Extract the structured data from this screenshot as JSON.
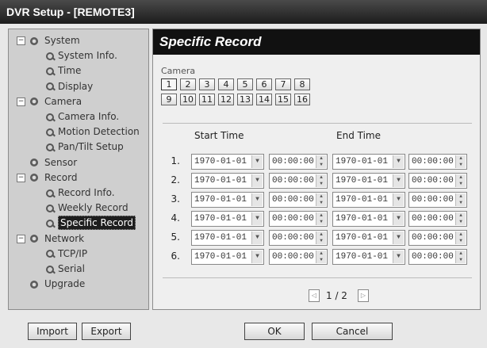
{
  "window": {
    "title": "DVR Setup - [REMOTE3]"
  },
  "sidebar": {
    "tree": [
      {
        "label": "System",
        "kind": "group",
        "expanded": true
      },
      {
        "label": "System Info.",
        "kind": "item"
      },
      {
        "label": "Time",
        "kind": "item"
      },
      {
        "label": "Display",
        "kind": "item"
      },
      {
        "label": "Camera",
        "kind": "group",
        "expanded": true
      },
      {
        "label": "Camera Info.",
        "kind": "item"
      },
      {
        "label": "Motion Detection",
        "kind": "item"
      },
      {
        "label": "Pan/Tilt Setup",
        "kind": "item"
      },
      {
        "label": "Sensor",
        "kind": "group",
        "expanded": false
      },
      {
        "label": "Record",
        "kind": "group",
        "expanded": true
      },
      {
        "label": "Record Info.",
        "kind": "item"
      },
      {
        "label": "Weekly Record",
        "kind": "item"
      },
      {
        "label": "Specific Record",
        "kind": "item",
        "selected": true
      },
      {
        "label": "Network",
        "kind": "group",
        "expanded": true
      },
      {
        "label": "TCP/IP",
        "kind": "item"
      },
      {
        "label": "Serial",
        "kind": "item"
      },
      {
        "label": "Upgrade",
        "kind": "group",
        "expanded": false
      }
    ],
    "expanded_symbol": "−"
  },
  "footer": {
    "import_label": "Import",
    "export_label": "Export",
    "ok_label": "OK",
    "cancel_label": "Cancel"
  },
  "main": {
    "title": "Specific Record",
    "camera_label": "Camera",
    "cameras": [
      "1",
      "2",
      "3",
      "4",
      "5",
      "6",
      "7",
      "8",
      "9",
      "10",
      "11",
      "12",
      "13",
      "14",
      "15",
      "16"
    ],
    "selected_camera": "1",
    "start_time_label": "Start Time",
    "end_time_label": "End Time",
    "rows": [
      {
        "num": "1.",
        "start_date": "1970-01-01",
        "start_time": "00:00:00",
        "end_date": "1970-01-01",
        "end_time": "00:00:00"
      },
      {
        "num": "2.",
        "start_date": "1970-01-01",
        "start_time": "00:00:00",
        "end_date": "1970-01-01",
        "end_time": "00:00:00"
      },
      {
        "num": "3.",
        "start_date": "1970-01-01",
        "start_time": "00:00:00",
        "end_date": "1970-01-01",
        "end_time": "00:00:00"
      },
      {
        "num": "4.",
        "start_date": "1970-01-01",
        "start_time": "00:00:00",
        "end_date": "1970-01-01",
        "end_time": "00:00:00"
      },
      {
        "num": "5.",
        "start_date": "1970-01-01",
        "start_time": "00:00:00",
        "end_date": "1970-01-01",
        "end_time": "00:00:00"
      },
      {
        "num": "6.",
        "start_date": "1970-01-01",
        "start_time": "00:00:00",
        "end_date": "1970-01-01",
        "end_time": "00:00:00"
      }
    ],
    "pager": {
      "text": "1 / 2",
      "prev_icon": "◁",
      "next_icon": "▷"
    }
  },
  "icons": {
    "dropdown": "▼",
    "spin_up": "▲",
    "spin_down": "▼"
  }
}
